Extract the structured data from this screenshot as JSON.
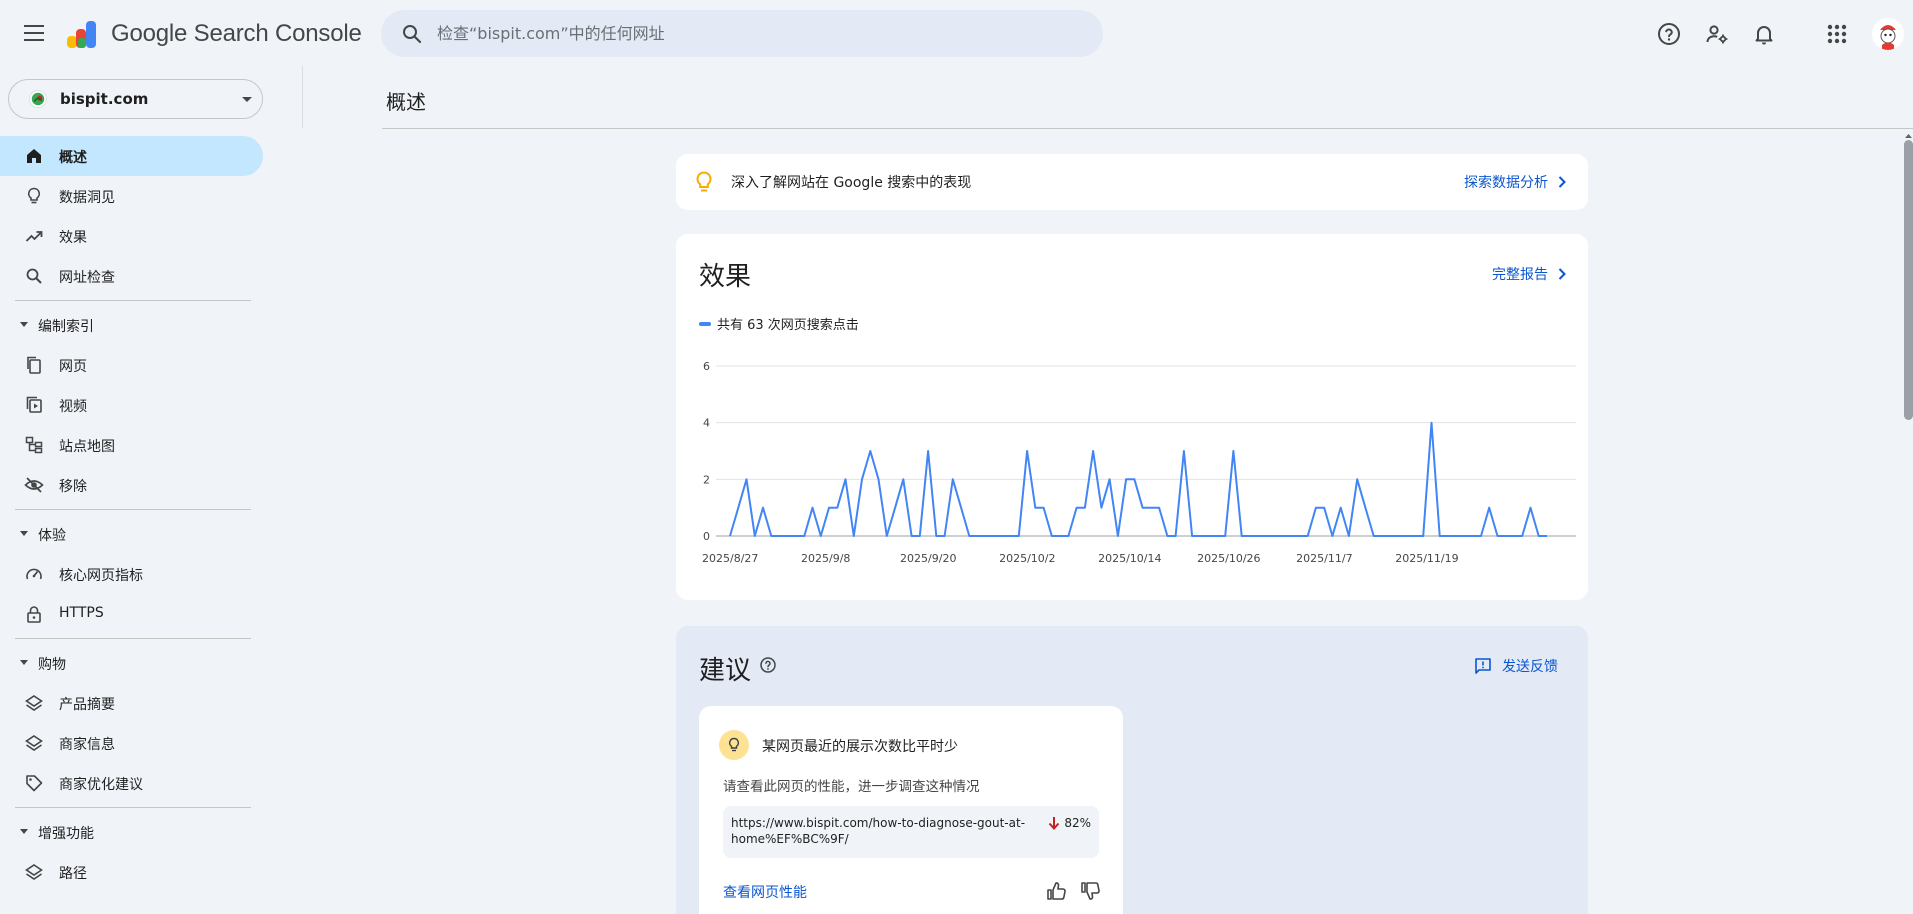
{
  "app": {
    "title": "Google Search Console"
  },
  "search": {
    "placeholder": "检查“bispit.com”中的任何网址"
  },
  "property": {
    "name": "bispit.com"
  },
  "nav": {
    "items": [
      {
        "label": "概述",
        "icon": "home-icon",
        "active": true
      },
      {
        "label": "数据洞见",
        "icon": "lightbulb-icon"
      },
      {
        "label": "效果",
        "icon": "trending-up-icon"
      },
      {
        "label": "网址检查",
        "icon": "search-icon"
      }
    ],
    "groups": {
      "index": {
        "label": "编制索引",
        "items": [
          "网页",
          "视频",
          "站点地图",
          "移除"
        ]
      },
      "experience": {
        "label": "体验",
        "items": [
          "核心网页指标",
          "HTTPS"
        ]
      },
      "shopping": {
        "label": "购物",
        "items": [
          "产品摘要",
          "商家信息",
          "商家优化建议"
        ]
      },
      "enhancements": {
        "label": "增强功能",
        "items": [
          "路径"
        ]
      }
    }
  },
  "main": {
    "title": "概述",
    "insight": {
      "text": "深入了解网站在 Google 搜索中的表现",
      "link": "探索数据分析"
    },
    "performance": {
      "heading": "效果",
      "link": "完整报告",
      "legend": "共有 63 次网页搜索点击"
    },
    "suggestions": {
      "heading": "建议",
      "feedback": "发送反馈",
      "card": {
        "title": "某网页最近的展示次数比平时少",
        "description": "请查看此网页的性能，进一步调查这种情况",
        "url": "https://www.bispit.com/how-to-diagnose-gout-at-home%EF%BC%9F/",
        "change": "82%",
        "action": "查看网页性能"
      }
    }
  },
  "colors": {
    "accent": "#0b57d0",
    "active_nav": "#c2e7ff",
    "line": "#4285f4",
    "down_arrow": "#c5221f"
  },
  "chart_data": {
    "type": "line",
    "series": [
      {
        "name": "共有 63 次网页搜索点击",
        "values": [
          0,
          1,
          2,
          0,
          1,
          0,
          0,
          0,
          0,
          0,
          1,
          0,
          1,
          1,
          2,
          0,
          2,
          3,
          2,
          0,
          1,
          2,
          0,
          0,
          3,
          0,
          0,
          2,
          1,
          0,
          0,
          0,
          0,
          0,
          0,
          0,
          3,
          1,
          1,
          0,
          0,
          0,
          1,
          1,
          3,
          1,
          2,
          0,
          2,
          2,
          1,
          1,
          1,
          0,
          0,
          3,
          0,
          0,
          0,
          0,
          0,
          3,
          0,
          0,
          0,
          0,
          0,
          0,
          0,
          0,
          0,
          1,
          1,
          0,
          1,
          0,
          2,
          1,
          0,
          0,
          0,
          0,
          0,
          0,
          0,
          4,
          0,
          0,
          0,
          0,
          0,
          0,
          1,
          0,
          0,
          0,
          0,
          1,
          0,
          0
        ]
      }
    ],
    "x_tick_labels": [
      "2025/8/27",
      "2025/9/8",
      "2025/9/20",
      "2025/10/2",
      "2025/10/14",
      "2025/10/26",
      "2025/11/7",
      "2025/11/19"
    ],
    "y_ticks": [
      0,
      2,
      4,
      6
    ],
    "ylim": [
      0,
      6
    ],
    "grid": true
  }
}
